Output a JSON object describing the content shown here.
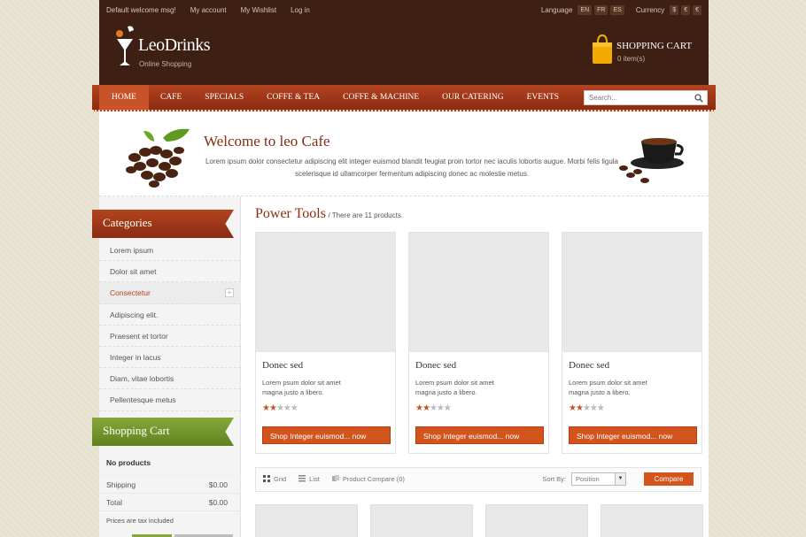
{
  "header": {
    "top_links": [
      "Default welcome msg!",
      "My account",
      "My Wishlist",
      "Log in"
    ],
    "language_label": "Language",
    "languages": [
      "EN",
      "FR",
      "ES"
    ],
    "currency_label": "Currency",
    "currencies": [
      "$",
      "€",
      "€"
    ],
    "logo_text": "LeoDrinks",
    "logo_sub": "Online Shopping",
    "cart_title": "SHOPPING CART",
    "cart_count": "0 item(s)"
  },
  "nav": {
    "items": [
      "HOME",
      "CAFE",
      "SPECIALS",
      "COFFE & TEA",
      "COFFE & MACHINE",
      "OUR CATERING",
      "EVENTS"
    ],
    "search_placeholder": "Search..."
  },
  "welcome": {
    "title": "Welcome to leo Cafe",
    "text": "Lorem ipsum dolor consectetur adipiscing elit integer euismod blandit feugiat proin tortor nec iaculis lobortis augue. Morbi felis ligula scelerisque id ullamcorper fermentum adipiscing donec ac molestie metus."
  },
  "sidebar": {
    "categories_title": "Categories",
    "categories": [
      "Lorem ipsum",
      "Dolor sit amet",
      "Consectetur",
      "Adipiscing elit.",
      "Praesent et tortor",
      "Integer in lacus",
      "Diam, vitae lobortis",
      "Pellentesque metus"
    ],
    "active_category": "Consectetur",
    "cart_title": "Shopping Cart",
    "no_products": "No products",
    "shipping_label": "Shipping",
    "shipping_value": "$0.00",
    "total_label": "Total",
    "total_value": "$0.00",
    "tax_note": "Prices are tax included"
  },
  "main": {
    "title": "Power Tools",
    "count_text": "/ There are 11 products.",
    "products": [
      {
        "name": "Donec sed",
        "desc": "Lorem psum dolor sit amet magna justo a libero.",
        "rating": 2,
        "button": "Shop Integer euismod... now"
      },
      {
        "name": "Donec sed",
        "desc": "Lorem psum dolor sit amet magna justo a libero.",
        "rating": 2,
        "button": "Shop Integer euismod... now"
      },
      {
        "name": "Donec sed",
        "desc": "Lorem psum dolor sit amet magna justo a libero.",
        "rating": 2,
        "button": "Shop Integer euismod... now"
      }
    ],
    "rating_max": 5,
    "toolbar": {
      "grid": "Grid",
      "list": "List",
      "compare_link": "Product Compare (0)",
      "sort_label": "Sort By:",
      "sort_value": "Position",
      "compare_button": "Compare"
    }
  },
  "colors": {
    "header_bg": "#3d1f13",
    "nav_red": "#b3431f",
    "accent_orange": "#d3541c",
    "ribbon_green": "#6f9428"
  }
}
